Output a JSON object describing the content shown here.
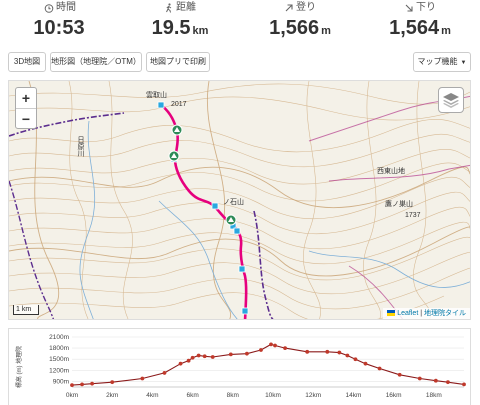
{
  "stats": [
    {
      "label": "時間",
      "icon": "clock-icon",
      "value": "10:53",
      "unit": ""
    },
    {
      "label": "距離",
      "icon": "walker-icon",
      "value": "19.5",
      "unit": "km"
    },
    {
      "label": "登り",
      "icon": "arrow-up-right-icon",
      "value": "1,566",
      "unit": "m"
    },
    {
      "label": "下り",
      "icon": "arrow-down-right-icon",
      "value": "1,564",
      "unit": "m"
    }
  ],
  "toolbar": {
    "buttons": [
      "3D地図",
      "地形図（地理院／OTM）",
      "地図プリで印刷"
    ],
    "map_menu": "マップ機能"
  },
  "map": {
    "zoom_in": "+",
    "zoom_out": "−",
    "scale": "1 km",
    "attribution_leaflet": "Leaflet",
    "attribution_sep": " | ",
    "attribution_tile": "地理院タイル",
    "labels": {
      "peak_top": "雲取山",
      "peak_top_elev": "2017",
      "peak_mid": "ノ石山",
      "river": "日原川",
      "place": "西東山地",
      "peak_right": "鷹ノ巣山",
      "peak_right_elev": "1737"
    },
    "colors": {
      "route": "#e6007e",
      "border": "#5b2d8e",
      "contour": "#c9a77c"
    }
  },
  "elevation": {
    "axis_title": "標高 (m) 地理院",
    "y_ticks": [
      "2100m",
      "1800m",
      "1500m",
      "1200m",
      "900m"
    ],
    "x_ticks": [
      "0km",
      "2km",
      "4km",
      "6km",
      "8km",
      "10km",
      "12km",
      "14km",
      "16km",
      "18km"
    ],
    "colors": {
      "line": "#8b1a1a",
      "marker": "#c0392b"
    }
  },
  "chart_data": {
    "type": "line",
    "xlabel": "",
    "ylabel": "標高 (m)",
    "xlim": [
      0,
      19.5
    ],
    "ylim": [
      750,
      2100
    ],
    "x": [
      0,
      0.5,
      1,
      2,
      3.5,
      4.6,
      5.4,
      5.8,
      6,
      6.3,
      6.6,
      7,
      7.9,
      8.7,
      9.4,
      9.9,
      10.1,
      10.6,
      11.7,
      12.7,
      13.3,
      13.7,
      14.1,
      14.6,
      15.3,
      16.3,
      17.3,
      18.1,
      18.7,
      19.5
    ],
    "y": [
      800,
      820,
      840,
      880,
      980,
      1130,
      1380,
      1460,
      1540,
      1600,
      1580,
      1560,
      1630,
      1650,
      1750,
      1900,
      1870,
      1800,
      1700,
      1700,
      1680,
      1600,
      1500,
      1380,
      1250,
      1080,
      980,
      920,
      880,
      820
    ]
  }
}
